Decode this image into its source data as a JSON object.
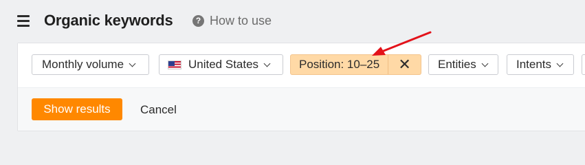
{
  "header": {
    "title": "Organic keywords",
    "help_link": "How to use"
  },
  "filters": {
    "monthly_volume": "Monthly volume",
    "country": "United States",
    "position": "Position: 10–25",
    "entities": "Entities",
    "intents": "Intents"
  },
  "actions": {
    "show_results": "Show results",
    "cancel": "Cancel"
  },
  "colors": {
    "accent": "#ff8800",
    "active_chip": "#ffd9a6",
    "annotation_arrow": "#e3121a"
  },
  "icons": [
    "menu-icon",
    "help-icon",
    "chevron-down-icon",
    "us-flag-icon",
    "close-icon",
    "annotation-arrow"
  ]
}
